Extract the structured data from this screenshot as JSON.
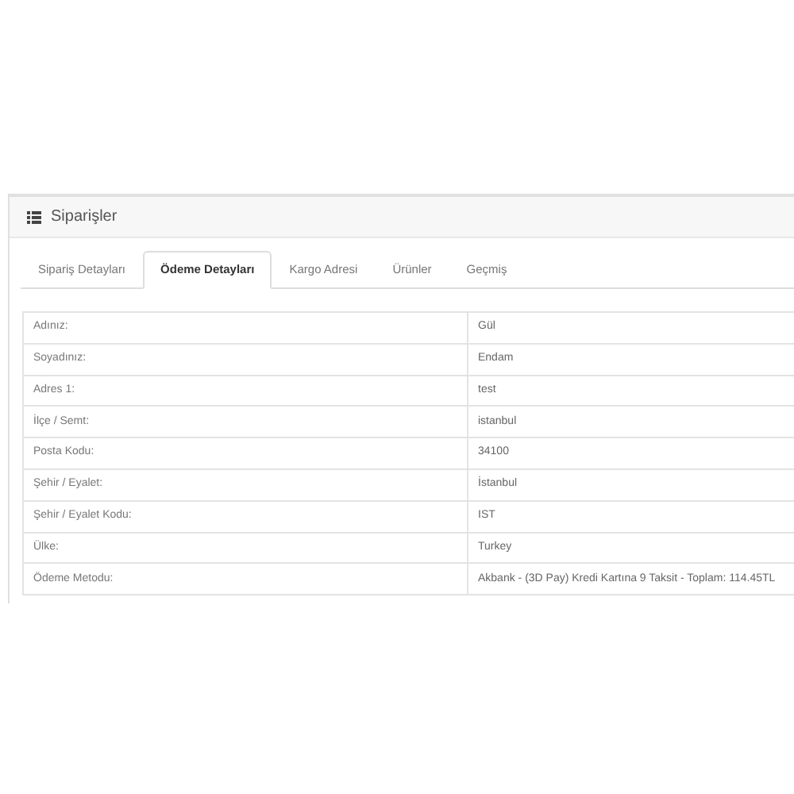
{
  "panel": {
    "title": "Siparişler"
  },
  "tabs": [
    {
      "label": "Sipariş Detayları",
      "selected": false
    },
    {
      "label": "Ödeme Detayları",
      "selected": true
    },
    {
      "label": "Kargo Adresi",
      "selected": false
    },
    {
      "label": "Ürünler",
      "selected": false
    },
    {
      "label": "Geçmiş",
      "selected": false
    }
  ],
  "table": {
    "rows": [
      {
        "label": "Adınız:",
        "value": "Gül"
      },
      {
        "label": "Soyadınız:",
        "value": "Endam"
      },
      {
        "label": "Adres 1:",
        "value": "test"
      },
      {
        "label": "İlçe / Semt:",
        "value": "istanbul"
      },
      {
        "label": "Posta Kodu:",
        "value": "34100"
      },
      {
        "label": "Şehir / Eyalet:",
        "value": "İstanbul"
      },
      {
        "label": "Şehir / Eyalet Kodu:",
        "value": "IST"
      },
      {
        "label": "Ülke:",
        "value": "Turkey"
      },
      {
        "label": "Ödeme Metodu:",
        "value": "Akbank - (3D Pay) Kredi Kartına 9 Taksit - Toplam: 114.45TL"
      }
    ]
  }
}
